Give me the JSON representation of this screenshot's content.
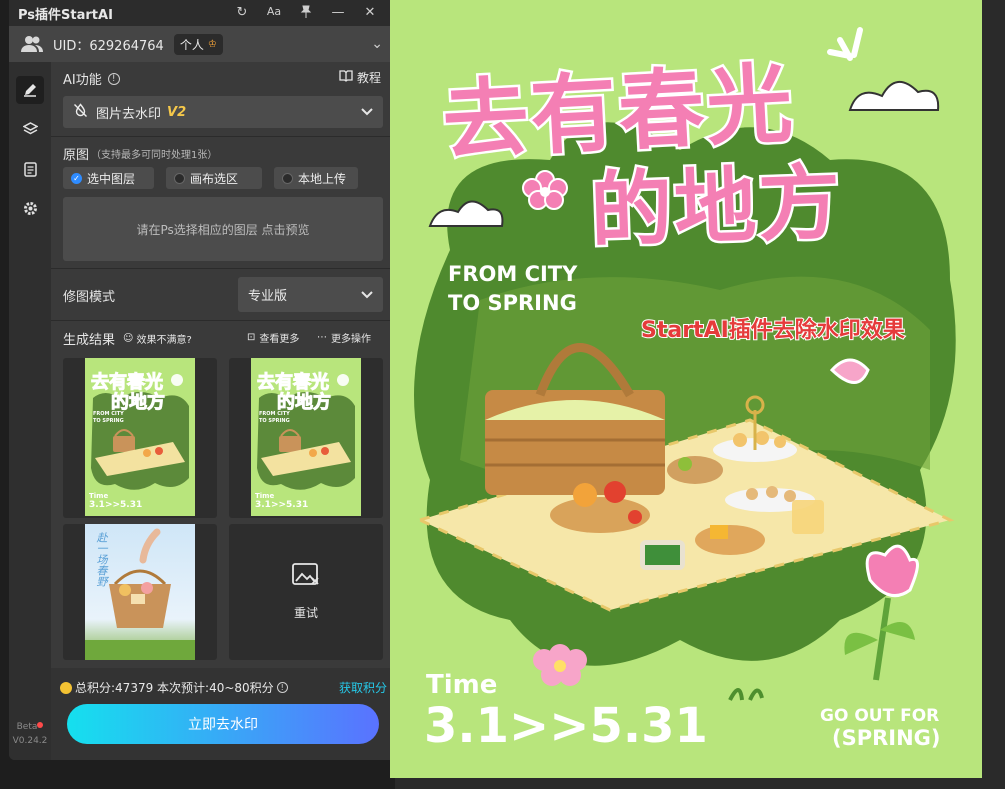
{
  "app": {
    "title": "Ps插件StartAI",
    "titlebar_icons": [
      "refresh-icon",
      "font-size-icon",
      "pin-icon",
      "minimize-icon",
      "close-icon"
    ]
  },
  "account": {
    "uid_text": "UID：629264764",
    "tier": "个人"
  },
  "sidebar": {
    "items": [
      "edit-icon",
      "layers-icon",
      "document-icon",
      "settings-icon"
    ],
    "beta_label": "Beta",
    "version": "V0.24.2"
  },
  "ai_function": {
    "label": "AI功能",
    "tutorial": "教程",
    "selected": "图片去水印",
    "selected_version": "V2"
  },
  "source": {
    "label": "原图",
    "note": "（支持最多可同时处理1张）",
    "options": [
      "选中图层",
      "画布选区",
      "本地上传"
    ],
    "selected_index": 0,
    "preview_hint": "请在Ps选择相应的图层 点击预览"
  },
  "mode": {
    "label": "修图模式",
    "value": "专业版"
  },
  "results": {
    "label": "生成结果",
    "unsatisfied": "效果不满意?",
    "view_more": "查看更多",
    "more_actions": "更多操作",
    "retry": "重试"
  },
  "points": {
    "summary": "总积分:47379  本次预计:40~80积分",
    "get_points": "获取积分"
  },
  "cta": "立即去水印",
  "canvas": {
    "title_line1": "去有春光",
    "title_line2": "的地方",
    "subtitle_line1": "FROM CITY",
    "subtitle_line2": "TO SPRING",
    "watermark_effect_text": "StartAI插件去除水印效果",
    "time_label": "Time",
    "date_range": "3.1>>5.31",
    "slogan_line1": "GO OUT FOR",
    "slogan_line2": "(SPRING)",
    "thumb_title": "去有春光",
    "thumb_title2": "的地方",
    "thumb_sub1": "FROM CITY",
    "thumb_sub2": "TO SPRING",
    "thumb_time": "Time",
    "thumb_date": "3.1>>5.31",
    "thumb3_text": "赴一场春野",
    "bg_color": "#b8e57c",
    "title_color": "#f47fb4"
  }
}
